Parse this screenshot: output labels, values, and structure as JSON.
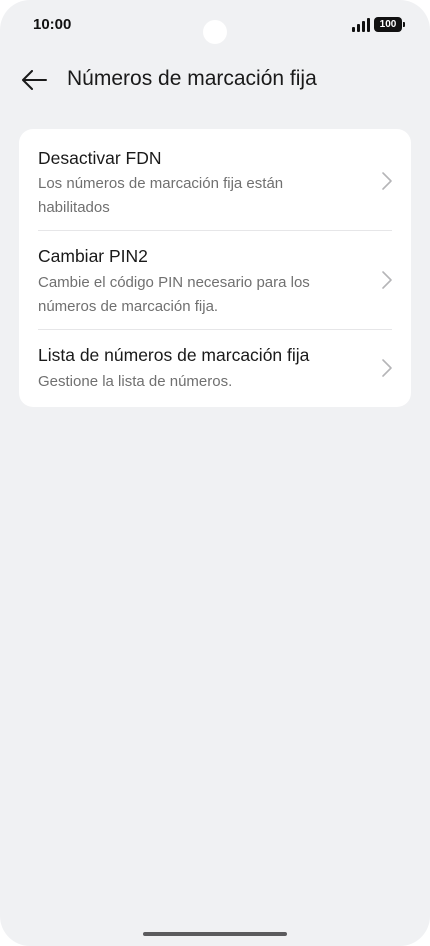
{
  "status_bar": {
    "time": "10:00",
    "battery": "100"
  },
  "header": {
    "title": "Números de marcación fija",
    "back_icon": "arrow-left-icon"
  },
  "settings": {
    "items": [
      {
        "title": "Desactivar FDN",
        "subtitle": "Los números de marcación fija están habilitados"
      },
      {
        "title": "Cambiar PIN2",
        "subtitle": "Cambie el código PIN necesario para los números de marcación fija."
      },
      {
        "title": "Lista de números de marcación fija",
        "subtitle": "Gestione la lista de números."
      }
    ]
  },
  "colors": {
    "background": "#f0f1f3",
    "card": "#ffffff",
    "secondary_text": "#707070"
  }
}
